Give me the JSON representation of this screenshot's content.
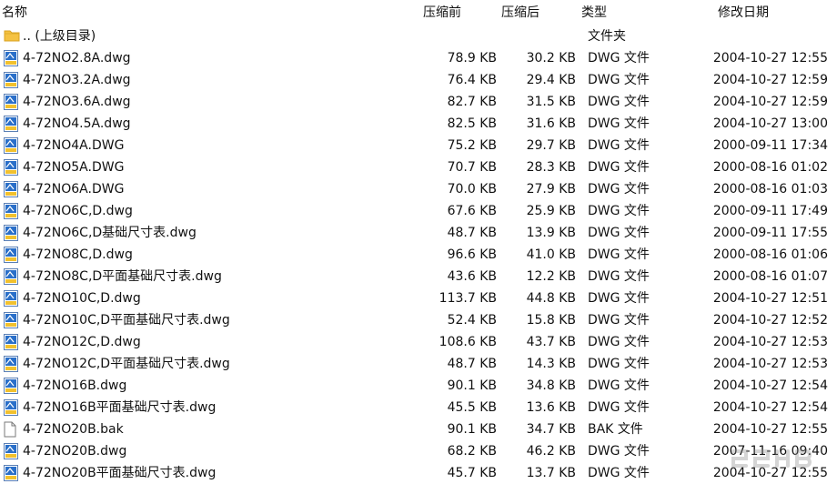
{
  "columns": {
    "name": "名称",
    "size": "压缩前",
    "compressed": "压缩后",
    "type": "类型",
    "modified": "修改日期"
  },
  "rows": [
    {
      "icon": "folder-icon",
      "name": ".. (上级目录)",
      "size": "",
      "compressed": "",
      "type": "文件夹",
      "modified": ""
    },
    {
      "icon": "dwg-file-icon",
      "name": "4-72NO2.8A.dwg",
      "size": "78.9 KB",
      "compressed": "30.2 KB",
      "type": "DWG 文件",
      "modified": "2004-10-27 12:55"
    },
    {
      "icon": "dwg-file-icon",
      "name": "4-72NO3.2A.dwg",
      "size": "76.4 KB",
      "compressed": "29.4 KB",
      "type": "DWG 文件",
      "modified": "2004-10-27 12:59"
    },
    {
      "icon": "dwg-file-icon",
      "name": "4-72NO3.6A.dwg",
      "size": "82.7 KB",
      "compressed": "31.5 KB",
      "type": "DWG 文件",
      "modified": "2004-10-27 12:59"
    },
    {
      "icon": "dwg-file-icon",
      "name": "4-72NO4.5A.dwg",
      "size": "82.5 KB",
      "compressed": "31.6 KB",
      "type": "DWG 文件",
      "modified": "2004-10-27 13:00"
    },
    {
      "icon": "dwg-file-icon",
      "name": "4-72NO4A.DWG",
      "size": "75.2 KB",
      "compressed": "29.7 KB",
      "type": "DWG 文件",
      "modified": "2000-09-11 17:34"
    },
    {
      "icon": "dwg-file-icon",
      "name": "4-72NO5A.DWG",
      "size": "70.7 KB",
      "compressed": "28.3 KB",
      "type": "DWG 文件",
      "modified": "2000-08-16 01:02"
    },
    {
      "icon": "dwg-file-icon",
      "name": "4-72NO6A.DWG",
      "size": "70.0 KB",
      "compressed": "27.9 KB",
      "type": "DWG 文件",
      "modified": "2000-08-16 01:03"
    },
    {
      "icon": "dwg-file-icon",
      "name": "4-72NO6C,D.dwg",
      "size": "67.6 KB",
      "compressed": "25.9 KB",
      "type": "DWG 文件",
      "modified": "2000-09-11 17:49"
    },
    {
      "icon": "dwg-file-icon",
      "name": "4-72NO6C,D基础尺寸表.dwg",
      "size": "48.7 KB",
      "compressed": "13.9 KB",
      "type": "DWG 文件",
      "modified": "2000-09-11 17:55"
    },
    {
      "icon": "dwg-file-icon",
      "name": "4-72NO8C,D.dwg",
      "size": "96.6 KB",
      "compressed": "41.0 KB",
      "type": "DWG 文件",
      "modified": "2000-08-16 01:06"
    },
    {
      "icon": "dwg-file-icon",
      "name": "4-72NO8C,D平面基础尺寸表.dwg",
      "size": "43.6 KB",
      "compressed": "12.2 KB",
      "type": "DWG 文件",
      "modified": "2000-08-16 01:07"
    },
    {
      "icon": "dwg-file-icon",
      "name": "4-72NO10C,D.dwg",
      "size": "113.7 KB",
      "compressed": "44.8 KB",
      "type": "DWG 文件",
      "modified": "2004-10-27 12:51"
    },
    {
      "icon": "dwg-file-icon",
      "name": "4-72NO10C,D平面基础尺寸表.dwg",
      "size": "52.4 KB",
      "compressed": "15.8 KB",
      "type": "DWG 文件",
      "modified": "2004-10-27 12:52"
    },
    {
      "icon": "dwg-file-icon",
      "name": "4-72NO12C,D.dwg",
      "size": "108.6 KB",
      "compressed": "43.7 KB",
      "type": "DWG 文件",
      "modified": "2004-10-27 12:53"
    },
    {
      "icon": "dwg-file-icon",
      "name": "4-72NO12C,D平面基础尺寸表.dwg",
      "size": "48.7 KB",
      "compressed": "14.3 KB",
      "type": "DWG 文件",
      "modified": "2004-10-27 12:53"
    },
    {
      "icon": "dwg-file-icon",
      "name": "4-72NO16B.dwg",
      "size": "90.1 KB",
      "compressed": "34.8 KB",
      "type": "DWG 文件",
      "modified": "2004-10-27 12:54"
    },
    {
      "icon": "dwg-file-icon",
      "name": "4-72NO16B平面基础尺寸表.dwg",
      "size": "45.5 KB",
      "compressed": "13.6 KB",
      "type": "DWG 文件",
      "modified": "2004-10-27 12:54"
    },
    {
      "icon": "blank-file-icon",
      "name": "4-72NO20B.bak",
      "size": "90.1 KB",
      "compressed": "34.7 KB",
      "type": "BAK 文件",
      "modified": "2004-10-27 12:55"
    },
    {
      "icon": "dwg-file-icon",
      "name": "4-72NO20B.dwg",
      "size": "68.2 KB",
      "compressed": "46.2 KB",
      "type": "DWG 文件",
      "modified": "2007-11-16 09:40"
    },
    {
      "icon": "dwg-file-icon",
      "name": "4-72NO20B平面基础尺寸表.dwg",
      "size": "45.7 KB",
      "compressed": "13.7 KB",
      "type": "DWG 文件",
      "modified": "2004-10-27 12:55"
    }
  ],
  "colors": {
    "dwg_icon_blue": "#2a6fc9",
    "dwg_icon_yellow": "#f2c12e",
    "folder_yellow": "#f5c242"
  }
}
